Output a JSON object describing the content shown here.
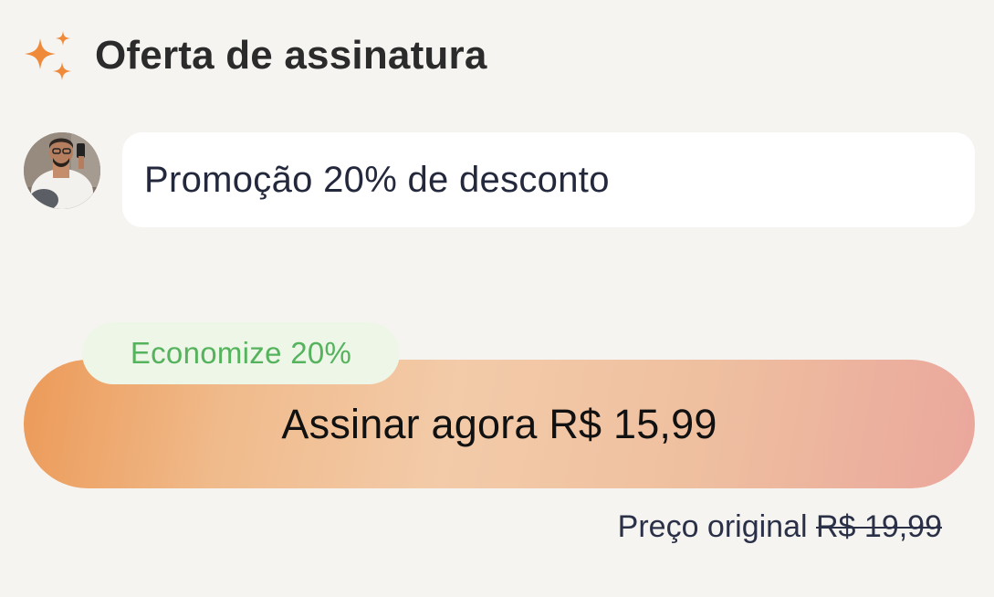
{
  "header": {
    "icon": "sparkles-icon",
    "title": "Oferta de assinatura"
  },
  "message": {
    "text": "Promoção 20% de desconto"
  },
  "offer": {
    "badge": "Economize 20%",
    "button_label": "Assinar agora R$ 15,99",
    "original_price_label": "Preço original",
    "original_price_value": "R$ 19,99"
  },
  "colors": {
    "accent": "#ef8a3a",
    "badge_text": "#55b35d",
    "badge_bg": "#eef6e8",
    "button_gradient_start": "#ec9a58",
    "button_gradient_end": "#eaa79c",
    "background": "#f6f4f1"
  }
}
